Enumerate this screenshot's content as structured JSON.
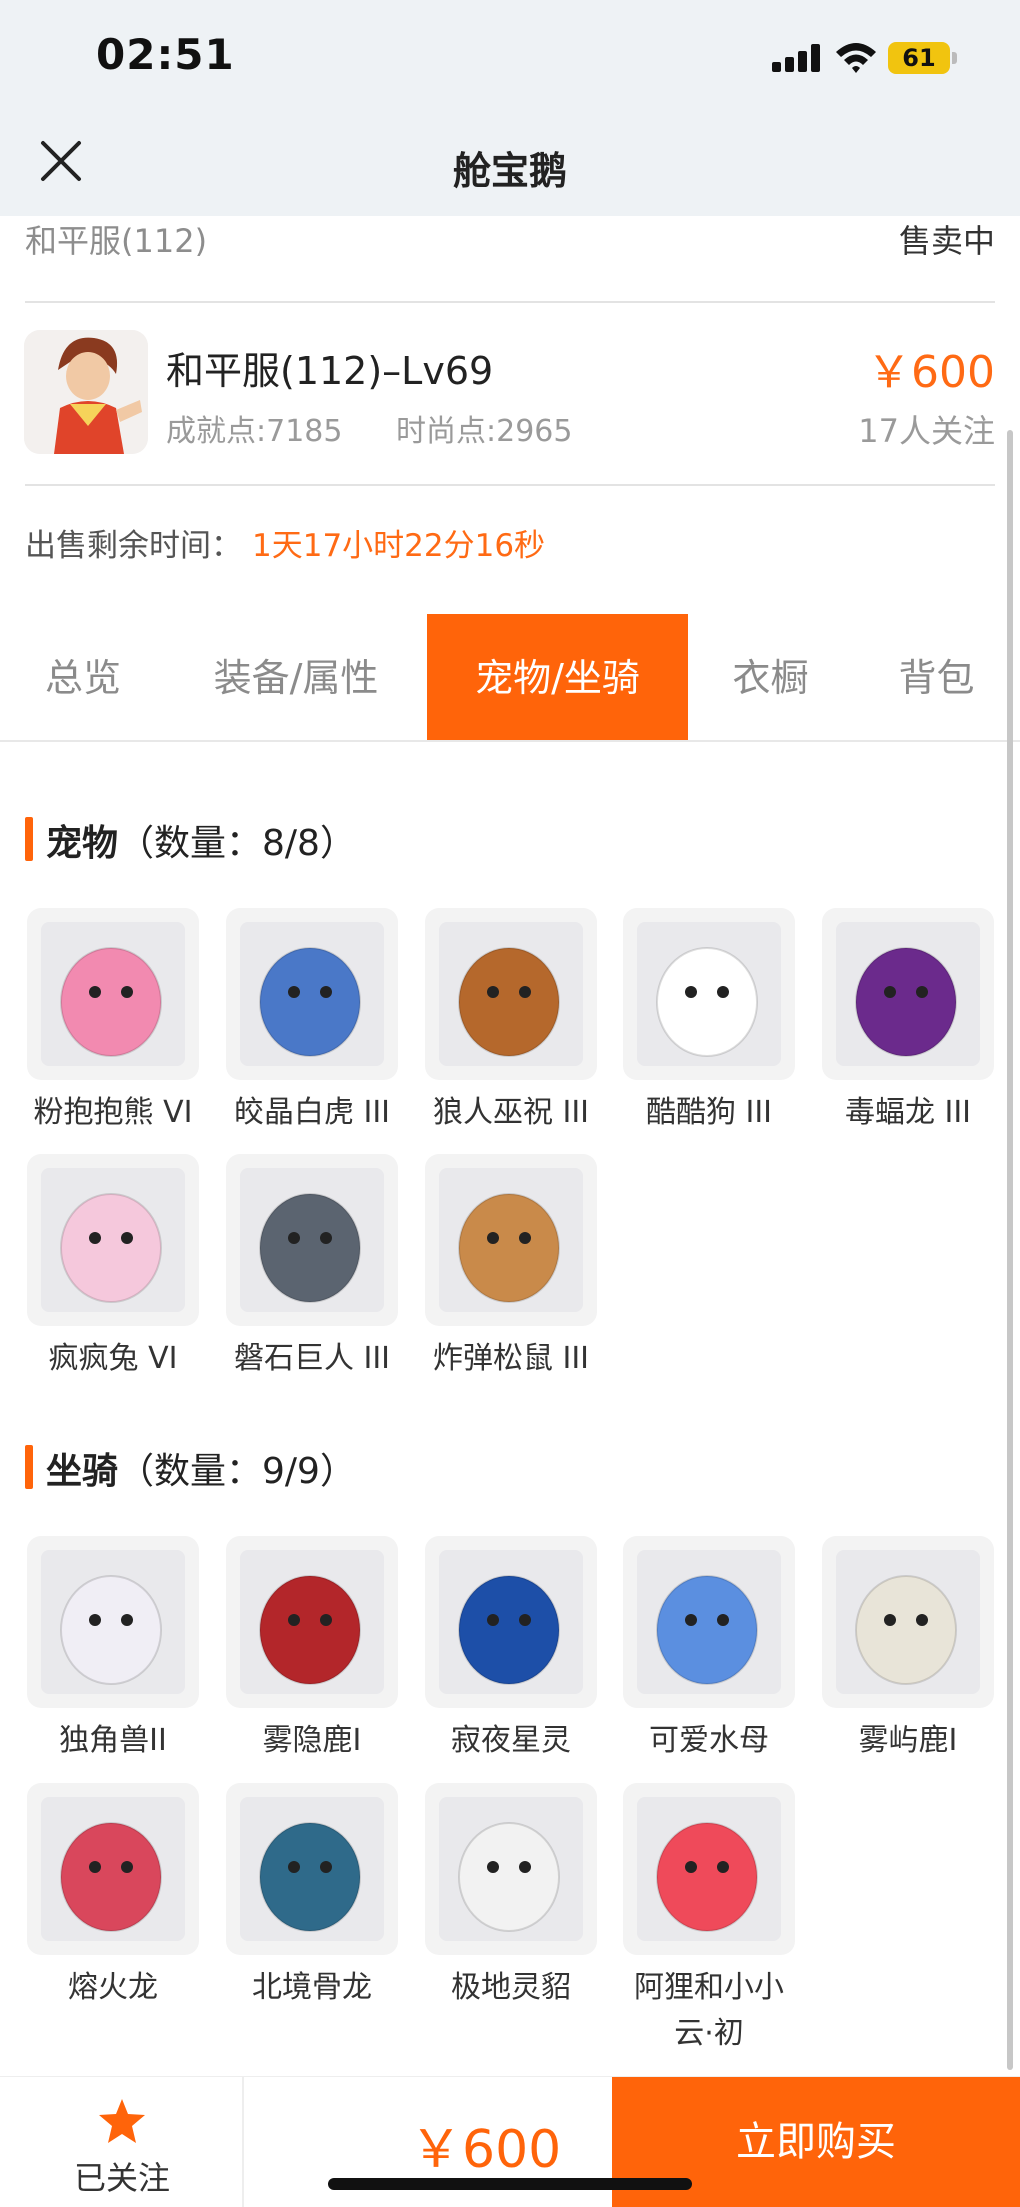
{
  "status_bar": {
    "time": "02:51",
    "battery": "61"
  },
  "header": {
    "title": "舱宝鹅"
  },
  "listing": {
    "server": "和平服(112)",
    "sale_status": "售卖中",
    "character_name": "和平服(112)–Lv69",
    "achievement": "成就点:7185",
    "fashion": "时尚点:2965",
    "price": "￥600",
    "followers": "17人关注",
    "remaining_label": "出售剩余时间：",
    "remaining_value": "1天17小时22分16秒"
  },
  "tabs": [
    {
      "label": "总览"
    },
    {
      "label": "装备/属性"
    },
    {
      "label": "宠物/坐骑",
      "active": true
    },
    {
      "label": "衣橱"
    },
    {
      "label": "背包"
    }
  ],
  "pets_section": {
    "title": "宠物",
    "count": "（数量：8/8）"
  },
  "pets": [
    {
      "name": "粉抱抱熊 VI",
      "icon": "pink-bear",
      "color": "#f28ab0"
    },
    {
      "name": "皎晶白虎 III",
      "icon": "white-tiger",
      "color": "#4a78c8"
    },
    {
      "name": "狼人巫祝 III",
      "icon": "werewolf",
      "color": "#b5682c"
    },
    {
      "name": "酷酷狗 III",
      "icon": "cool-dog",
      "color": "#ffffff"
    },
    {
      "name": "毒蝠龙 III",
      "icon": "bat-dragon",
      "color": "#6b2a8c"
    },
    {
      "name": "疯疯兔 VI",
      "icon": "crazy-rabbit",
      "color": "#f5c8dc"
    },
    {
      "name": "磐石巨人 III",
      "icon": "rock-giant",
      "color": "#5b6470"
    },
    {
      "name": "炸弹松鼠 III",
      "icon": "bomb-squirrel",
      "color": "#c98a4a"
    }
  ],
  "mounts_section": {
    "title": "坐骑",
    "count": "（数量：9/9）"
  },
  "mounts": [
    {
      "name": "独角兽II",
      "icon": "unicorn",
      "color": "#f0eef5"
    },
    {
      "name": "雾隐鹿I",
      "icon": "mist-deer",
      "color": "#b3262a"
    },
    {
      "name": "寂夜星灵",
      "icon": "night-spirit",
      "color": "#1d4fa8"
    },
    {
      "name": "可爱水母",
      "icon": "jellyfish",
      "color": "#5b8fe0"
    },
    {
      "name": "雾屿鹿I",
      "icon": "island-deer",
      "color": "#e8e4d8"
    },
    {
      "name": "熔火龙",
      "icon": "fire-dragon",
      "color": "#d9475c"
    },
    {
      "name": "北境骨龙",
      "icon": "bone-dragon",
      "color": "#2f6a8a"
    },
    {
      "name": "极地灵貂",
      "icon": "polar-marten",
      "color": "#f2f2f2"
    },
    {
      "name": "阿狸和小小云·初",
      "icon": "ali-cloud",
      "color": "#ef4a5a"
    }
  ],
  "bottom": {
    "follow_label": "已关注",
    "price": "￥600",
    "buy_label": "立即购买"
  },
  "accent_color": "#ff640a"
}
